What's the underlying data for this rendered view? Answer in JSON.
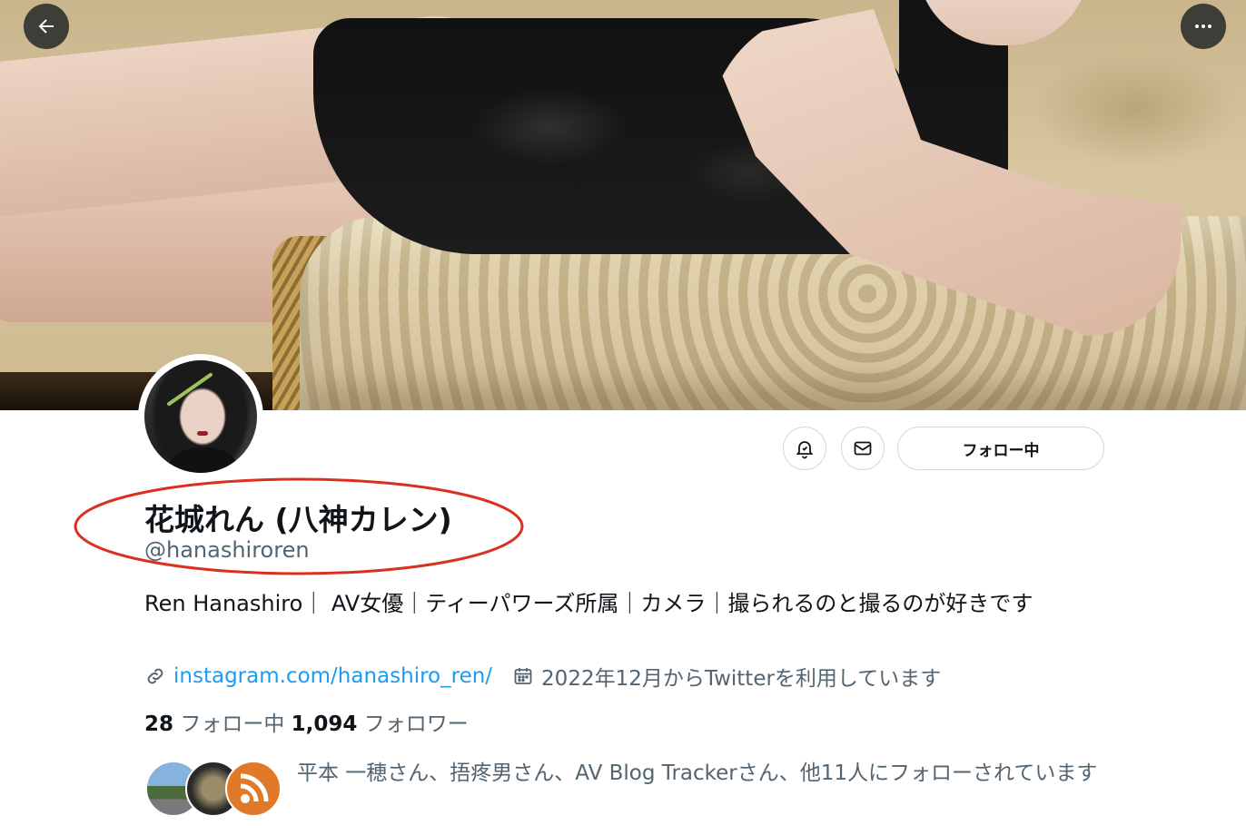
{
  "profile": {
    "display_name": "花城れん (八神カレン)",
    "handle": "@hanashiroren",
    "bio": "Ren Hanashiro｜ AV女優｜ティーパワーズ所属｜カメラ｜撮られるのと撮るのが好きです",
    "link": "instagram.com/hanashiro_ren/",
    "joined": "2022年12月からTwitterを利用しています",
    "following_count": "28",
    "following_label": "フォロー中",
    "followers_count": "1,094",
    "followers_label": "フォロワー",
    "followed_by": "平本 一穂さん、捂疼男さん、AV Blog Trackerさん、他11人にフォローされています"
  },
  "actions": {
    "follow_button_label": "フォロー中"
  },
  "icons": {
    "back": "back-arrow-icon",
    "more": "more-icon",
    "bell": "notification-bell-icon",
    "mail": "mail-icon",
    "link": "link-icon",
    "calendar": "calendar-icon"
  },
  "colors": {
    "accent": "#1d9bf0",
    "secondary_text": "#536471",
    "annotation": "#d9301f"
  }
}
